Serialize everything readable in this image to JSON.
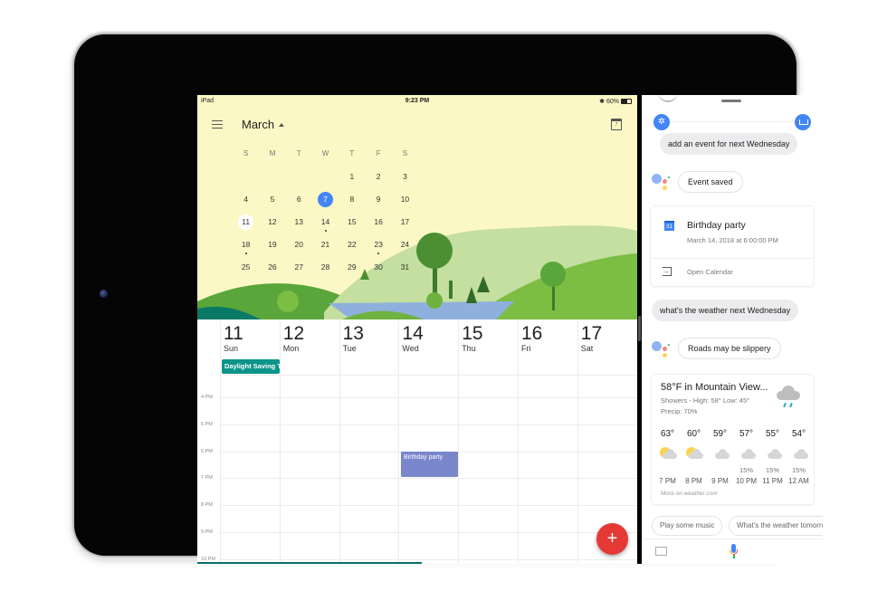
{
  "status_bar": {
    "device": "iPad",
    "time": "9:23 PM",
    "battery": "60%"
  },
  "calendar": {
    "month_title": "March",
    "today_icon_day": "7",
    "weekday_headers": [
      "S",
      "M",
      "T",
      "W",
      "T",
      "F",
      "S"
    ],
    "mini_weeks": [
      [
        "",
        "",
        "",
        "",
        "1",
        "2",
        "3"
      ],
      [
        "4",
        "5",
        "6",
        "7",
        "8",
        "9",
        "10"
      ],
      [
        "11",
        "12",
        "13",
        "14",
        "15",
        "16",
        "17"
      ],
      [
        "18",
        "19",
        "20",
        "21",
        "22",
        "23",
        "24"
      ],
      [
        "25",
        "26",
        "27",
        "28",
        "29",
        "30",
        "31"
      ]
    ],
    "selected_day": "7",
    "highlighted_day": "11",
    "days_with_events": [
      "14",
      "18",
      "23"
    ],
    "week_days": [
      {
        "num": "11",
        "name": "Sun"
      },
      {
        "num": "12",
        "name": "Mon"
      },
      {
        "num": "13",
        "name": "Tue"
      },
      {
        "num": "14",
        "name": "Wed"
      },
      {
        "num": "15",
        "name": "Thu"
      },
      {
        "num": "16",
        "name": "Fri"
      },
      {
        "num": "17",
        "name": "Sat"
      }
    ],
    "all_day_event": "Daylight Saving Time",
    "hour_labels": [
      "4 PM",
      "5 PM",
      "6 PM",
      "7 PM",
      "8 PM",
      "9 PM",
      "10 PM"
    ],
    "timed_event": "Birthday party",
    "fab_label": "+",
    "colors": {
      "header_bg": "#fbf8c5",
      "selected": "#4285f4",
      "all_day_event": "#0b9488",
      "timed_event": "#7986cb",
      "fab": "#e53935"
    }
  },
  "assistant": {
    "user_query_1": "add an event for next Wednesday",
    "reply_1": "Event saved",
    "event_card": {
      "icon_day": "31",
      "title": "Birthday party",
      "datetime": "March 14, 2018 at 6:00:00 PM",
      "action": "Open Calendar"
    },
    "user_query_2": "what's the weather next Wednesday",
    "reply_2": "Roads may be slippery",
    "weather_card": {
      "title": "58°F in Mountain View...",
      "conditions": "Showers - High: 58° Low: 45°",
      "precip": "Precip: 70%",
      "hourly": [
        {
          "temp": "63°",
          "icon": "partly-cloudy",
          "precip": "",
          "time": "7 PM"
        },
        {
          "temp": "60°",
          "icon": "partly-cloudy",
          "precip": "",
          "time": "8 PM"
        },
        {
          "temp": "59°",
          "icon": "cloudy",
          "precip": "",
          "time": "9 PM"
        },
        {
          "temp": "57°",
          "icon": "cloudy",
          "precip": "15%",
          "time": "10 PM"
        },
        {
          "temp": "55°",
          "icon": "cloudy",
          "precip": "15%",
          "time": "11 PM"
        },
        {
          "temp": "54°",
          "icon": "cloudy",
          "precip": "15%",
          "time": "12 AM"
        }
      ],
      "source": "More on weather.com"
    },
    "suggestions": [
      "Play some music",
      "What's the weather tomorrow"
    ],
    "colors": {
      "accent": "#4285f4",
      "user_bubble": "#ececee"
    }
  }
}
